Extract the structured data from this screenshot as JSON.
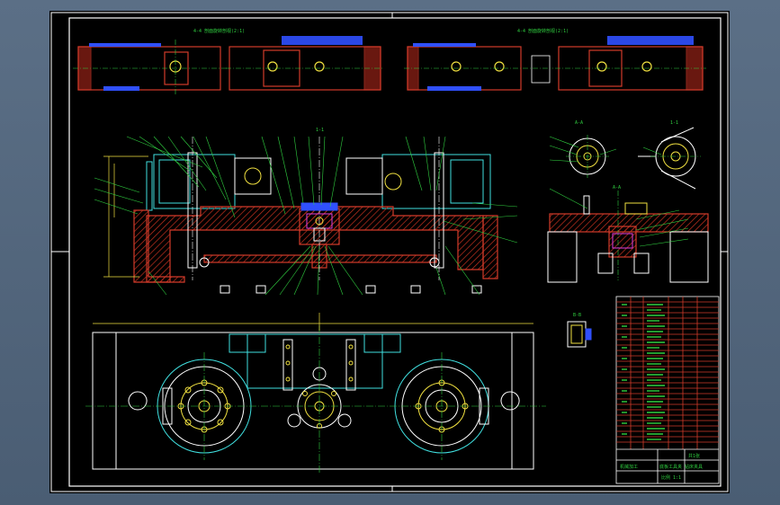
{
  "drawing": {
    "top_left_caption": "4-4 剖面旋转剖视(2:1)",
    "top_right_caption": "4-4 剖面旋转剖视(2:1)",
    "section_labels": [
      "1-1",
      "A-A",
      "1-1",
      "A-A",
      "B-B",
      "A-A"
    ],
    "title_block": {
      "name_line": "底板工具夹 钻床夹具",
      "org_line": "机械加工",
      "scale_line": "比例 1:1",
      "sheet_label": "共1张"
    }
  },
  "colors": {
    "frame_white": "#ffffff",
    "part_red": "#d23b2a",
    "hatch_red": "#b0281c",
    "cyan": "#40e0e0",
    "yellow": "#f0e040",
    "green": "#30d040",
    "blue": "#3050ff",
    "magenta": "#e040e0"
  }
}
